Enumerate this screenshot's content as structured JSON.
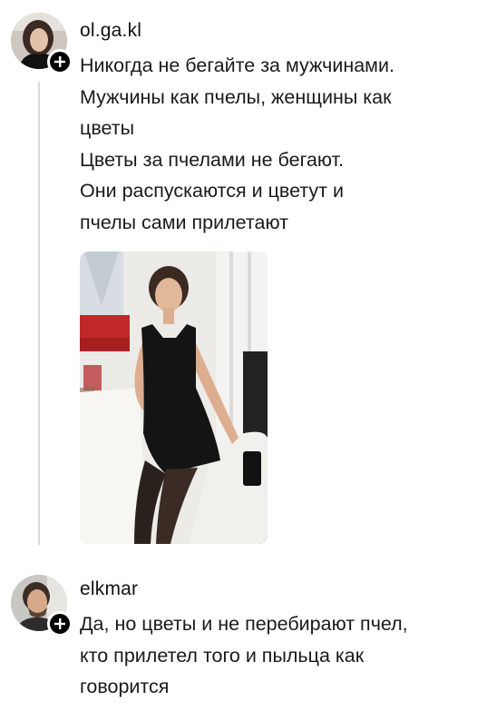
{
  "posts": [
    {
      "username": "ol.ga.kl",
      "avatar": "avatar-photo",
      "follow_icon": "plus-icon",
      "lines": [
        "Никогда не бегайте за мужчинами.",
        "Мужчины как пчелы, женщины как",
        "цветы",
        "Цветы за пчелами не бегают.",
        "Они распускаются и цветут и",
        "пчелы сами прилетают"
      ],
      "attachment": "photo-woman-in-black-dress"
    },
    {
      "username": "elkmar",
      "avatar": "avatar-photo",
      "follow_icon": "plus-icon",
      "lines": [
        "Да, но цветы и не перебирают пчел,",
        "кто прилетел того и пыльца как",
        "говорится"
      ]
    }
  ],
  "colors": {
    "background": "#ffffff",
    "text": "#1a1a1a",
    "thread_line": "#d9d9d9",
    "badge": "#000000"
  }
}
